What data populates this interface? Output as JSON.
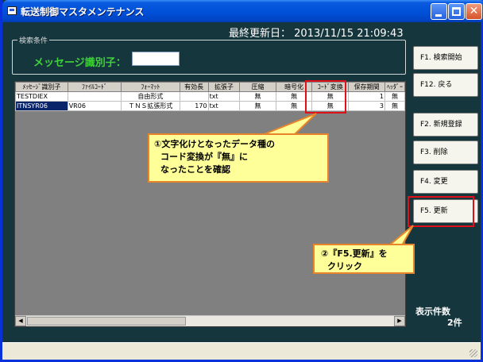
{
  "window": {
    "title": "転送制御マスタメンテナンス"
  },
  "header": {
    "last_updated_label": "最終更新日：",
    "last_updated_value": "2013/11/15  21:09:43"
  },
  "search": {
    "legend": "検索条件",
    "label": "メッセージ識別子：",
    "value": ""
  },
  "table": {
    "columns": [
      "ﾒｯｾｰｼﾞ識別子",
      "ﾌｧｲﾙｺｰﾄﾞ",
      "ﾌｫｰﾏｯﾄ",
      "有効長",
      "拡張子",
      "圧縮",
      "暗号化",
      "ｺｰﾄﾞ変換",
      "保存期間",
      "ﾍｯﾀﾞｰ"
    ],
    "rows": [
      [
        "TESTDIEX",
        "",
        "自由形式",
        "",
        "txt",
        "無",
        "無",
        "無",
        "1",
        "無"
      ],
      [
        "ITNSYR06",
        "VR06",
        "ＴＮＳ拡張形式",
        "170",
        "txt",
        "無",
        "無",
        "無",
        "3",
        "無"
      ]
    ]
  },
  "buttons": {
    "f1": "F1. 検索開始",
    "f12": "F12. 戻る",
    "f2": "F2. 新規登録",
    "f3": "F3. 削除",
    "f4": "F4. 変更",
    "f5": "F5. 更新"
  },
  "count": {
    "label": "表示件数",
    "value": "2件"
  },
  "callouts": {
    "note1_line1": "①文字化けとなったデータ種の",
    "note1_line2": "コード変換が『無』に",
    "note1_line3": "なったことを確認",
    "note2_line1": "②『F5.更新』を",
    "note2_line2": "クリック"
  }
}
